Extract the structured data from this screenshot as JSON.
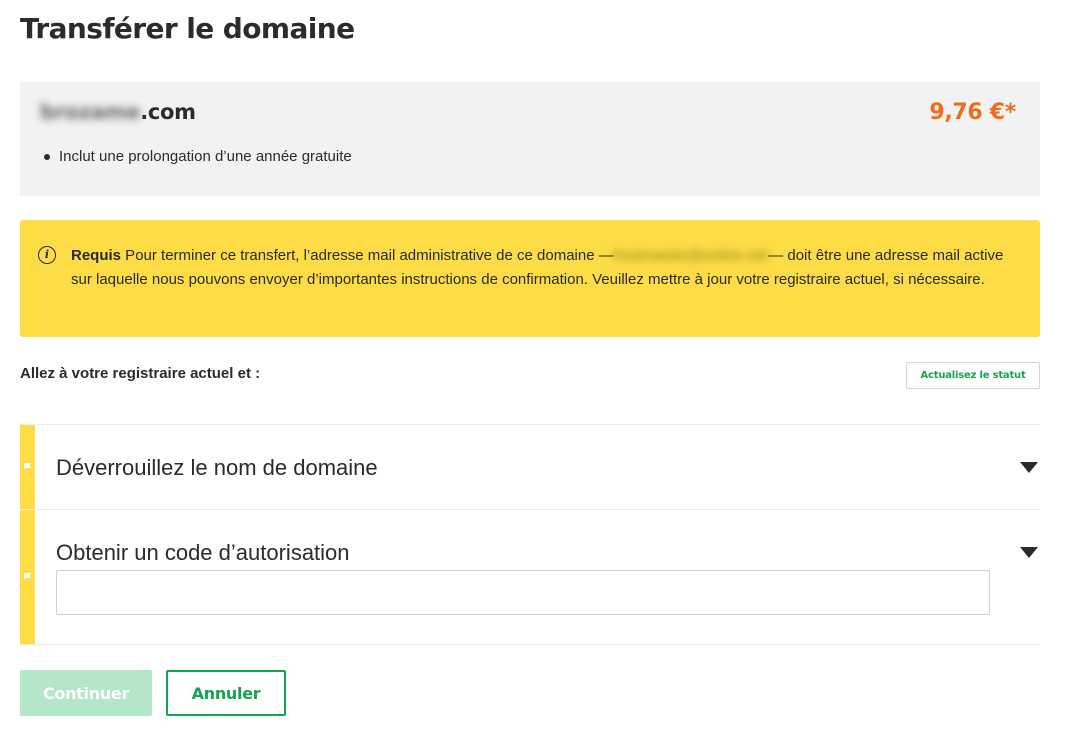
{
  "page": {
    "title": "Transférer le domaine"
  },
  "domain_card": {
    "name_blurred": "brozame",
    "name_suffix": ".com",
    "price": "9,76 €*",
    "feature": "Inclut une prolongation d’une année gratuite"
  },
  "alert": {
    "icon": "info-icon",
    "strong": "Requis",
    "text_before": " Pour terminer ce transfert, l’adresse mail administrative de ce domaine —",
    "email_blurred": "hostmaster@online.net",
    "text_after": "— doit être une adresse mail active sur laquelle nous pouvons envoyer d’importantes instructions de confirmation. Veuillez mettre à jour votre registraire actuel, si nécessaire."
  },
  "registrar": {
    "label": "Allez à votre registraire actuel et :",
    "status_button": "Actualisez le statut"
  },
  "steps": [
    {
      "title": "Déverrouillez le nom de domaine"
    },
    {
      "title": "Obtenir un code d’autorisation",
      "input_value": "",
      "input_placeholder": ""
    }
  ],
  "actions": {
    "continue": "Continuer",
    "cancel": "Annuler"
  },
  "colors": {
    "accent_green": "#14a44d",
    "disabled_green": "#b4e6c8",
    "price_orange": "#f26b1d",
    "alert_yellow": "#fddc45",
    "card_gray": "#f2f2f2"
  }
}
